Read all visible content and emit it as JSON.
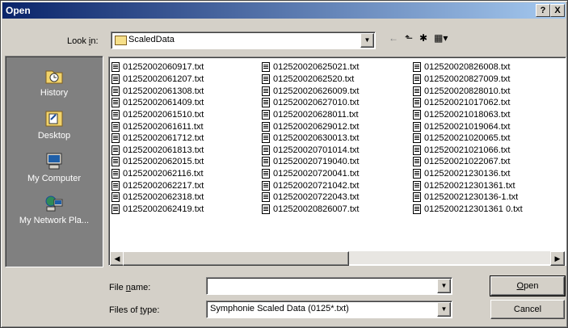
{
  "window": {
    "title": "Open",
    "help_label": "?",
    "close_label": "X"
  },
  "lookin": {
    "label_pre": "Look ",
    "label_key": "i",
    "label_post": "n:",
    "value": "ScaledData",
    "folder_icon": "folder-icon"
  },
  "toolbar": {
    "back": "←",
    "up": "⬑",
    "new_folder": "✱",
    "view": "▦▾"
  },
  "places": [
    {
      "label": "History",
      "icon": "history-icon"
    },
    {
      "label": "Desktop",
      "icon": "desktop-icon"
    },
    {
      "label": "My Computer",
      "icon": "computer-icon"
    },
    {
      "label": "My Network Pla...",
      "icon": "network-icon"
    }
  ],
  "files": {
    "col1": [
      "01252002060917.txt",
      "01252002061207.txt",
      "01252002061308.txt",
      "01252002061409.txt",
      "01252002061510.txt",
      "01252002061611.txt",
      "01252002061712.txt",
      "01252002061813.txt",
      "01252002062015.txt",
      "01252002062116.txt",
      "01252002062217.txt",
      "01252002062318.txt",
      "01252002062419.txt"
    ],
    "col2": [
      "012520020625021.txt",
      "01252002062520.txt",
      "012520020626009.txt",
      "012520020627010.txt",
      "012520020628011.txt",
      "012520020629012.txt",
      "012520020630013.txt",
      "012520020701014.txt",
      "012520020719040.txt",
      "012520020720041.txt",
      "012520020721042.txt",
      "012520020722043.txt",
      "012520020826007.txt"
    ],
    "col3": [
      "012520020826008.txt",
      "012520020827009.txt",
      "012520020828010.txt",
      "012520021017062.txt",
      "012520021018063.txt",
      "012520021019064.txt",
      "012520021020065.txt",
      "012520021021066.txt",
      "012520021022067.txt",
      "012520021230136.txt",
      "0125200212301361.txt",
      "012520021230136-1.txt",
      "0125200212301361 0.txt"
    ]
  },
  "filename": {
    "label_pre": "File ",
    "label_key": "n",
    "label_post": "ame:",
    "value": ""
  },
  "filetype": {
    "label_pre": "Files of ",
    "label_key": "t",
    "label_post": "ype:",
    "value": "Symphonie Scaled Data (0125*.txt)"
  },
  "buttons": {
    "open_key": "O",
    "open_rest": "pen",
    "cancel": "Cancel"
  }
}
